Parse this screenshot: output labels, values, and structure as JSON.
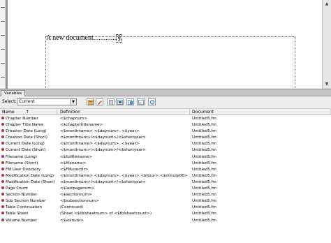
{
  "document": {
    "text": "A new document",
    "leader": ".............",
    "cursor_glyph": "§"
  },
  "panel": {
    "tab_label": "Variables",
    "select_label": "Select:",
    "select_value": "Current"
  },
  "toolbar_icons": [
    "insert-variable-icon",
    "edit-variable-icon",
    "delete-variable-icon",
    "convert-variable-icon",
    "import-icon",
    "show-definition-icon",
    "refresh-icon"
  ],
  "columns": {
    "name": "Name",
    "sort_indicator": "↑",
    "definition": "Definition",
    "document": "Document"
  },
  "rows": [
    {
      "name": "Chapter Number",
      "definition": "<$chapnum>",
      "document": "Untitled5.fm"
    },
    {
      "name": "Chapter Title Name",
      "definition": "<$chaptertitlename>",
      "document": "Untitled5.fm"
    },
    {
      "name": "Creation Date (Long)",
      "definition": "<$monthname> <$daynum>, <$year>",
      "document": "Untitled5.fm"
    },
    {
      "name": "Creation Date (Short)",
      "definition": "<$monthnum>/<$daynum>/<$shortyear>",
      "document": "Untitled5.fm"
    },
    {
      "name": "Current Date (Long)",
      "definition": "<$monthname> <$daynum>, <$year>",
      "document": "Untitled5.fm"
    },
    {
      "name": "Current Date (Short)",
      "definition": "<$monthnum>/<$daynum>/<$shortyear>",
      "document": "Untitled5.fm"
    },
    {
      "name": "Filename (Long)",
      "definition": "<$fullfilename>",
      "document": "Untitled5.fm"
    },
    {
      "name": "Filename (Short)",
      "definition": "<$filename>",
      "document": "Untitled5.fm"
    },
    {
      "name": "FM User Directory",
      "definition": "<$FMuserdir>",
      "document": "Untitled5.fm"
    },
    {
      "name": "Modification Date (Long)",
      "definition": "<$monthname> <$daynum>, <$year> <$hour>:<$minute00> <$amp...",
      "document": "Untitled5.fm"
    },
    {
      "name": "Modification Date (Short)",
      "definition": "<$monthnum>/<$daynum>/<$shortyear>",
      "document": "Untitled5.fm"
    },
    {
      "name": "Page Count",
      "definition": "<$lastpagenum>",
      "document": "Untitled5.fm"
    },
    {
      "name": "Section Number",
      "definition": "<$sectionnum>",
      "document": "Untitled5.fm"
    },
    {
      "name": "Sub Section Number",
      "definition": "<$subsectionnum>",
      "document": "Untitled5.fm"
    },
    {
      "name": "Table Continuation",
      "definition": "(Continued)",
      "document": "Untitled5.fm"
    },
    {
      "name": "Table Sheet",
      "definition": "(Sheet <$tblsheetnum> of <$tblsheetcount>)",
      "document": "Untitled5.fm"
    },
    {
      "name": "Volume Number",
      "definition": "<$volnum>",
      "document": "Untitled5.fm"
    }
  ],
  "colors": {
    "bullet": "#b03040"
  }
}
